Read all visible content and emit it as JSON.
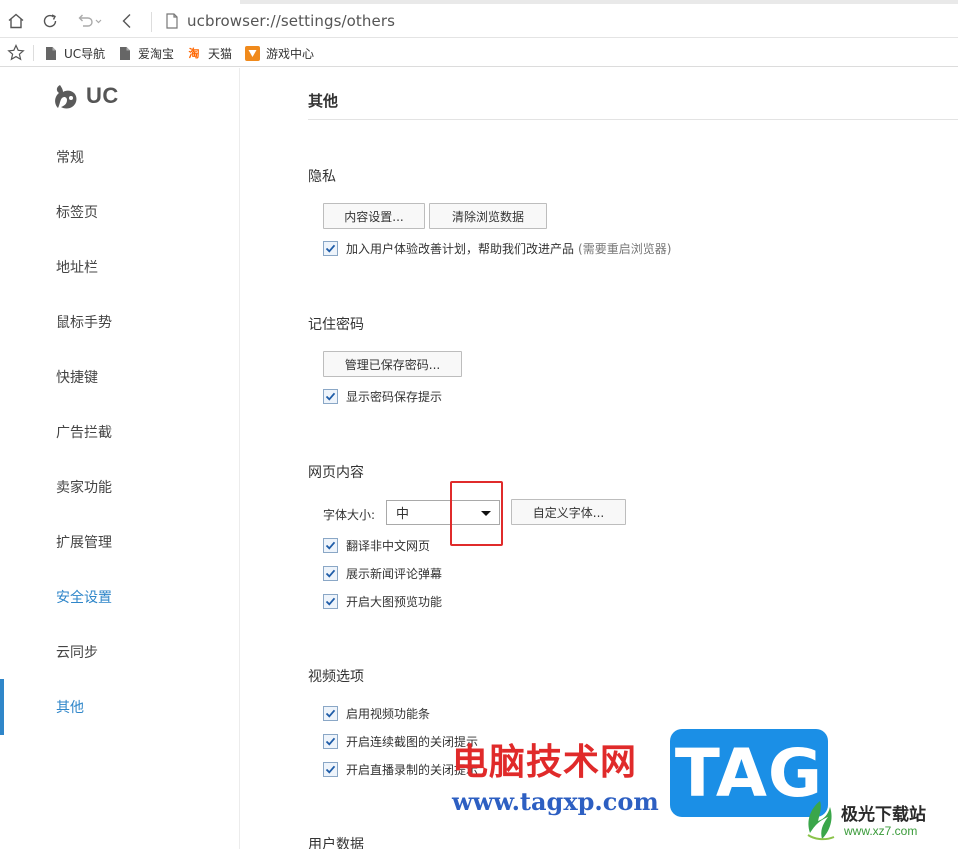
{
  "toolbar": {
    "url": "ucbrowser://settings/others"
  },
  "bookmarks": [
    {
      "label": "UC导航"
    },
    {
      "label": "爱淘宝"
    },
    {
      "label": "天猫"
    },
    {
      "label": "游戏中心"
    }
  ],
  "bookmark_icon_texts": {
    "tmall": "淘"
  },
  "sidebar": {
    "logo_text": "UC",
    "items": [
      {
        "label": "常规"
      },
      {
        "label": "标签页"
      },
      {
        "label": "地址栏"
      },
      {
        "label": "鼠标手势"
      },
      {
        "label": "快捷键"
      },
      {
        "label": "广告拦截"
      },
      {
        "label": "卖家功能"
      },
      {
        "label": "扩展管理"
      },
      {
        "label": "安全设置"
      },
      {
        "label": "云同步"
      },
      {
        "label": "其他"
      }
    ],
    "active_item": "其他"
  },
  "main": {
    "title": "其他",
    "privacy": {
      "title": "隐私",
      "content_settings_button": "内容设置...",
      "clear_data_button": "清除浏览数据",
      "ux_plan_label": "加入用户体验改善计划，帮助我们改进产品",
      "ux_plan_hint": "(需要重启浏览器)",
      "ux_plan_checked": true
    },
    "passwords": {
      "title": "记住密码",
      "manage_button": "管理已保存密码...",
      "show_prompt_label": "显示密码保存提示",
      "show_prompt_checked": true
    },
    "web_content": {
      "title": "网页内容",
      "font_size_label": "字体大小:",
      "font_size_value": "中",
      "custom_font_button": "自定义字体...",
      "options": [
        {
          "label": "翻译非中文网页",
          "checked": true
        },
        {
          "label": "展示新闻评论弹幕",
          "checked": true
        },
        {
          "label": "开启大图预览功能",
          "checked": true
        }
      ]
    },
    "video": {
      "title": "视频选项",
      "options": [
        {
          "label": "启用视频功能条",
          "checked": true
        },
        {
          "label": "开启连续截图的关闭提示",
          "checked": true
        },
        {
          "label": "开启直播录制的关闭提示",
          "checked": true
        }
      ]
    },
    "user_data": {
      "title": "用户数据"
    }
  },
  "watermark": {
    "cn_text": "电脑技术网",
    "url_text": "www.tagxp.com",
    "tag_text": "TAG",
    "site_cn": "极光下载站",
    "site_url": "www.xz7.com"
  },
  "colors": {
    "accent": "#2f86c9",
    "highlight": "#e02b2b",
    "watermark_red": "#e02a2a",
    "watermark_blue": "#1b8fe6"
  }
}
